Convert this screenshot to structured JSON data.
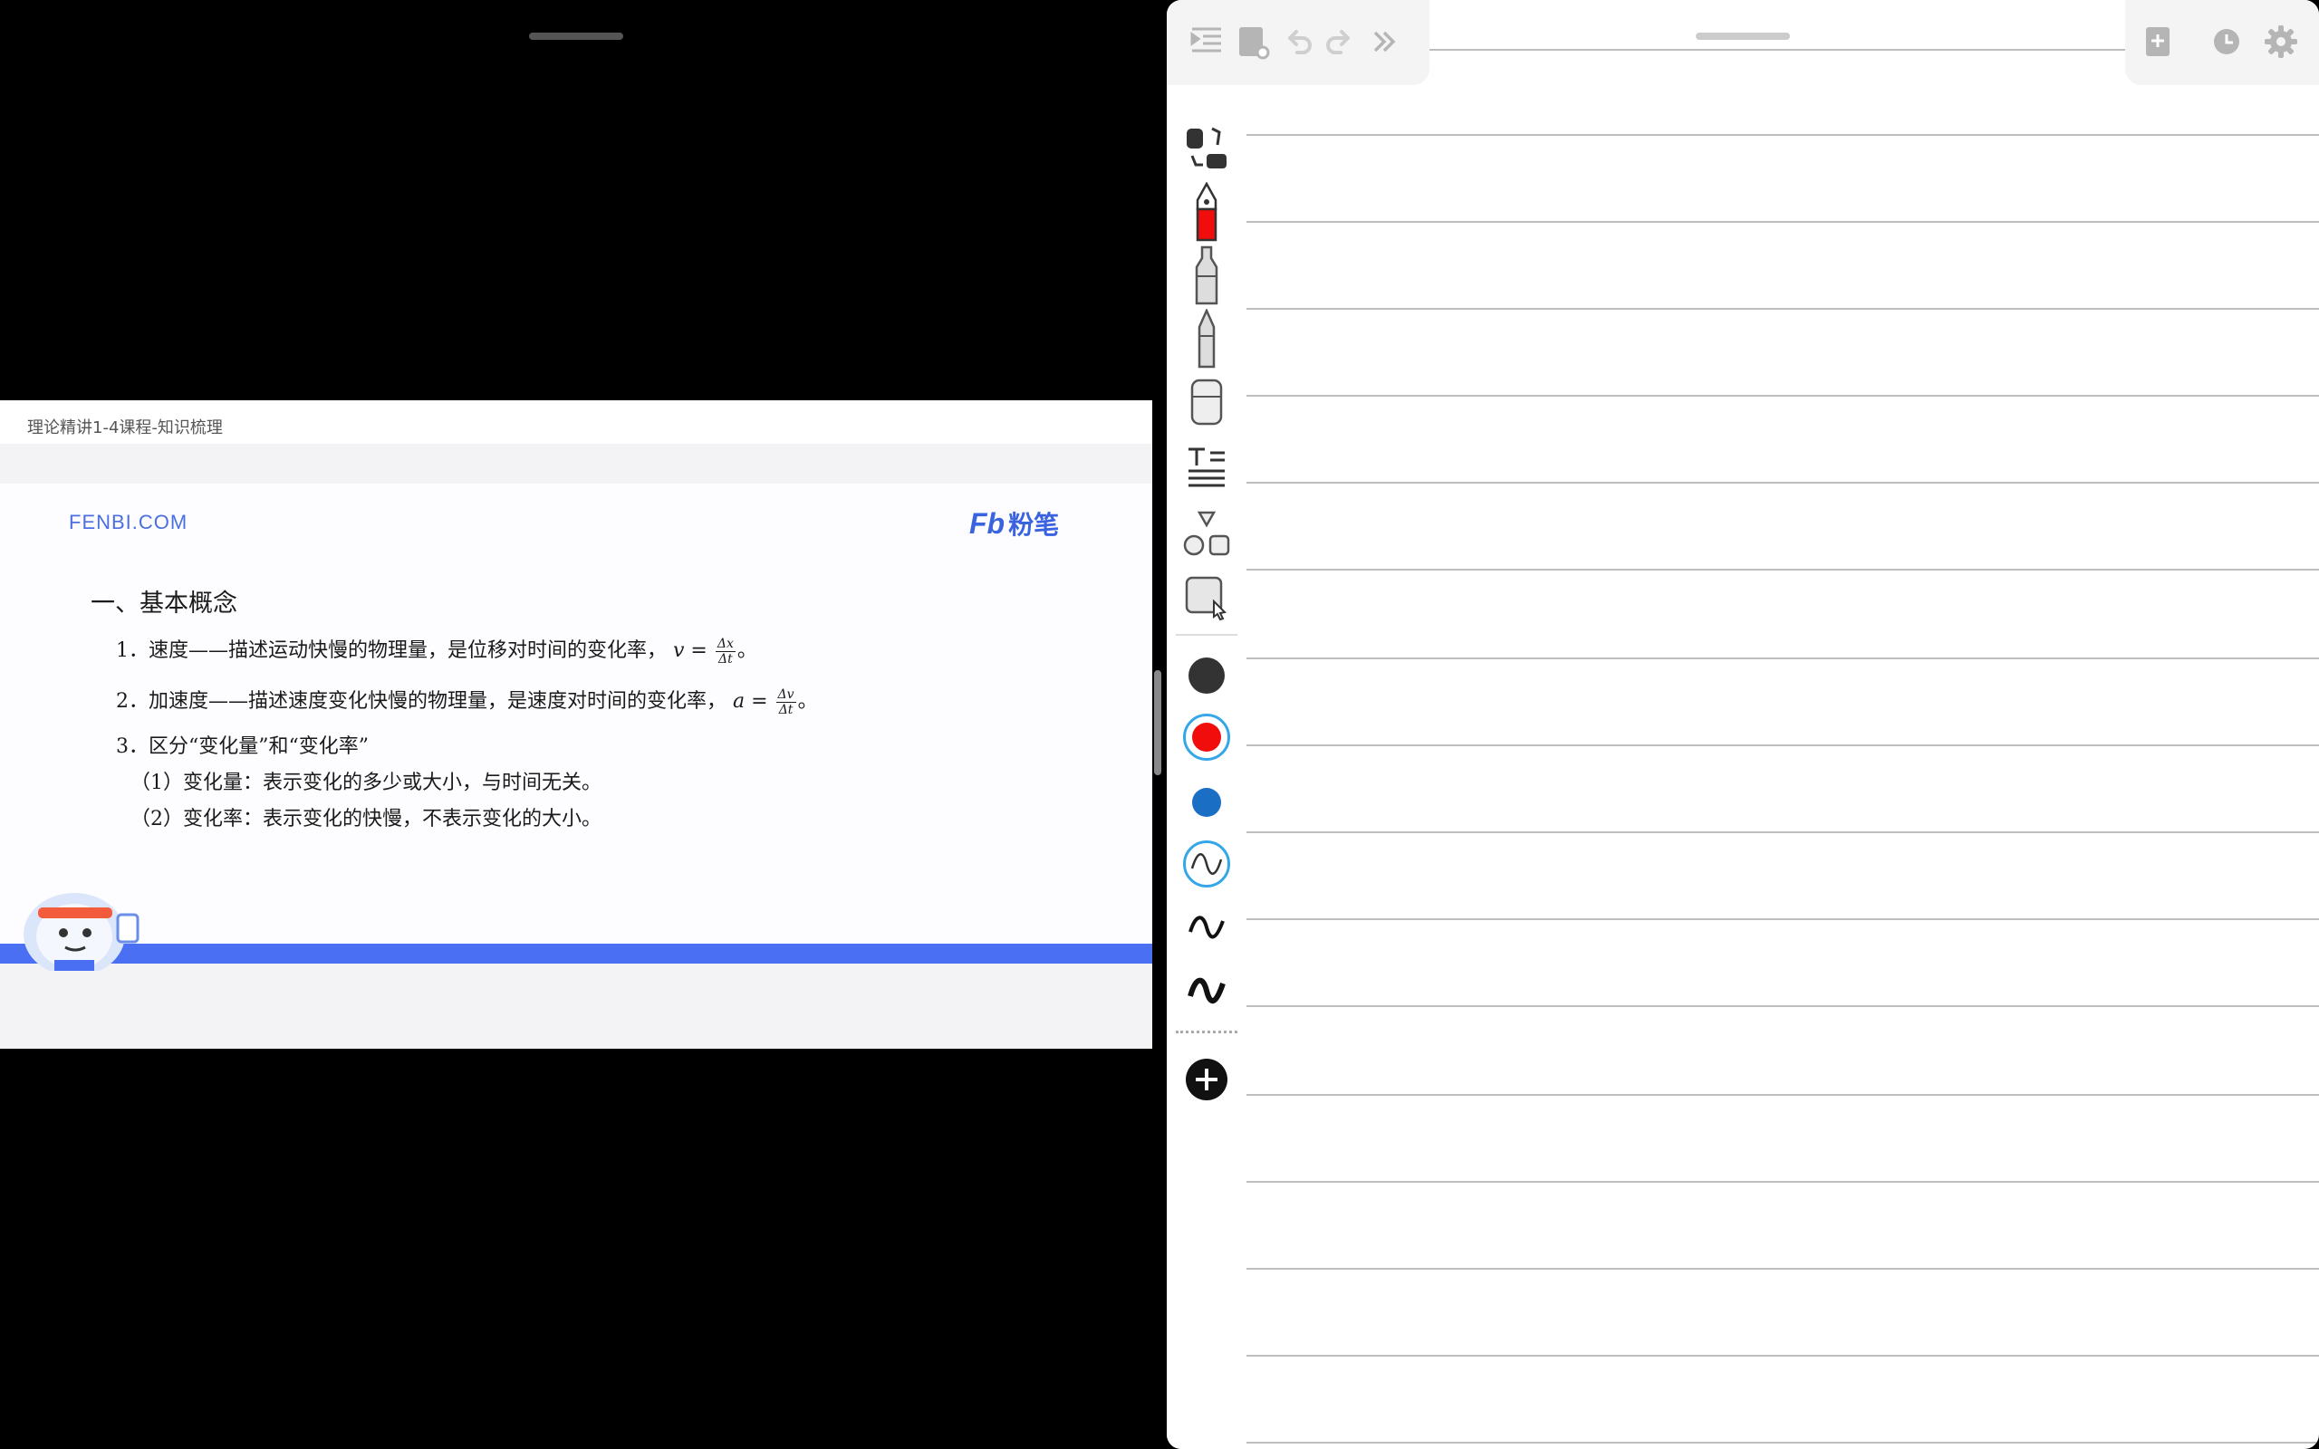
{
  "slide": {
    "title": "理论精讲1-4课程-知识梳理",
    "site": "FENBI.COM",
    "logo_mark": "Fb",
    "logo_text": "粉笔",
    "heading": "一、基本概念",
    "item1": {
      "text": "1．速度——描述运动快慢的物理量，是位移对时间的变化率，",
      "var": "v =",
      "num": "Δx",
      "den": "Δt",
      "end": "。"
    },
    "item2": {
      "text": "2．加速度——描述速度变化快慢的物理量，是速度对时间的变化率，",
      "var": "a =",
      "num": "Δv",
      "den": "Δt",
      "end": "。"
    },
    "item3": "3．区分“变化量”和“变化率”",
    "sub1": "（1）变化量：表示变化的多少或大小，与时间无关。",
    "sub2": "（2）变化率：表示变化的快慢，不表示变化的大小。"
  },
  "notes": {
    "top_left_icons": [
      "outline-icon",
      "notebook-icon",
      "undo-icon",
      "redo-icon",
      "expand-icon"
    ],
    "top_right_icons": [
      "add-page-icon",
      "history-icon",
      "settings-icon"
    ],
    "tools": [
      "lasso-icon",
      "fountain-pen-icon",
      "marker-icon",
      "highlighter-icon",
      "eraser-icon",
      "text-icon",
      "shapes-icon",
      "image-select-icon"
    ],
    "colors": [
      {
        "name": "black",
        "hex": "#333333",
        "selected": false
      },
      {
        "name": "red",
        "hex": "#f20d0d",
        "selected": true
      },
      {
        "name": "blue",
        "hex": "#1a6fc4",
        "selected": false
      }
    ],
    "stroke_widths": [
      {
        "name": "thin",
        "selected": true
      },
      {
        "name": "medium",
        "selected": false
      },
      {
        "name": "thick",
        "selected": false
      }
    ],
    "add_icon": "plus-icon"
  },
  "colors": {
    "brand_blue": "#4a6ff3",
    "accent_cyan": "#35a6e8"
  }
}
